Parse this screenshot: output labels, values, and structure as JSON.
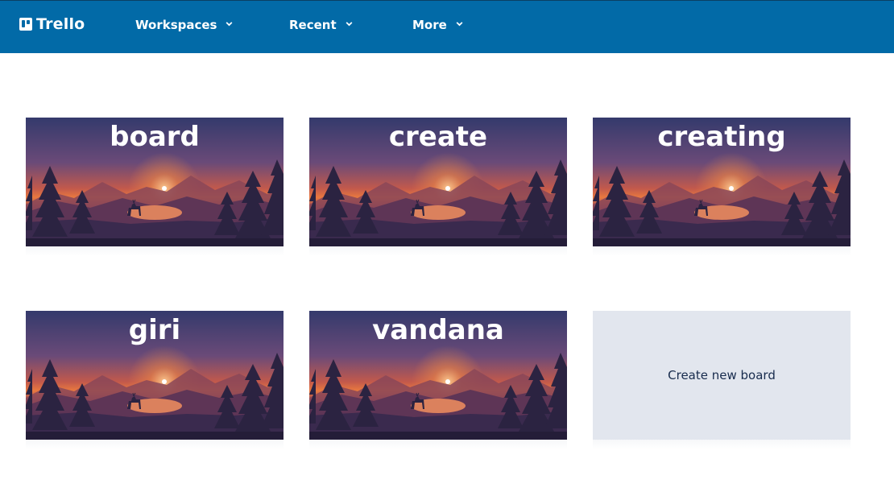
{
  "app": {
    "logo_text": "Trello"
  },
  "nav": {
    "workspaces": "Workspaces",
    "recent": "Recent",
    "more": "More"
  },
  "boards": [
    {
      "title": "board"
    },
    {
      "title": "create"
    },
    {
      "title": "creating"
    },
    {
      "title": "giri"
    },
    {
      "title": "vandana"
    }
  ],
  "create_board": {
    "label": "Create new board"
  },
  "colors": {
    "header": "#026aa7",
    "create_tile_bg": "#e2e6ee",
    "sky_top": "#3a3e70",
    "sky_glow": "#e06b3a"
  },
  "icons": {
    "logo": "trello-logo-icon",
    "dropdown": "chevron-down-icon"
  }
}
